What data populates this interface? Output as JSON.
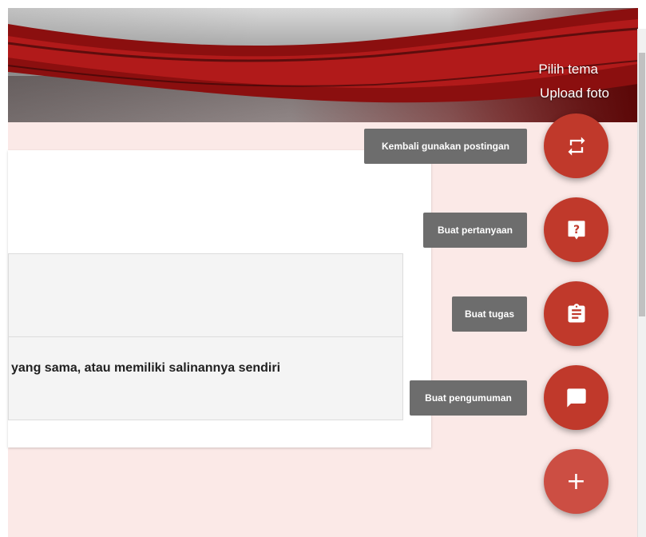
{
  "banner": {
    "choose_theme": "Pilih tema",
    "upload_photo": "Upload foto"
  },
  "reuse_dialog": {
    "option_text": "yang sama, atau memiliki salinannya sendiri"
  },
  "speed_dial": {
    "items": [
      {
        "label": "Kembali gunakan postingan",
        "icon": "repeat-icon"
      },
      {
        "label": "Buat pertanyaan",
        "icon": "question-icon"
      },
      {
        "label": "Buat tugas",
        "icon": "assignment-icon"
      },
      {
        "label": "Buat pengumuman",
        "icon": "announcement-icon"
      }
    ],
    "main_label": "+"
  },
  "colors": {
    "fab": "#c0392b",
    "fab_main": "#cc4e43",
    "page_background": "#fbe9e7",
    "tooltip": "#6d6d6d"
  }
}
